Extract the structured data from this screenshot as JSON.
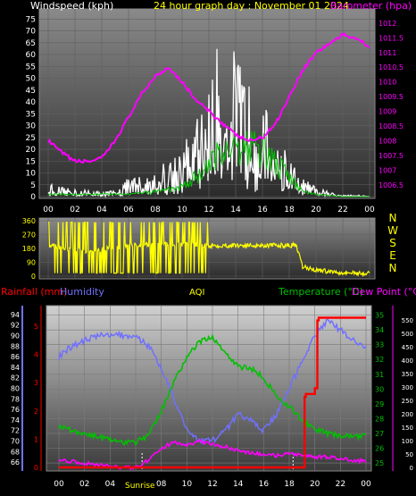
{
  "title": "24 hour graph day : November 01 2024",
  "colors": {
    "wind": "#ffffff",
    "gust": "#ffffff",
    "wind_avg": "#00c000",
    "baro": "#ff00ff",
    "dir": "#ffff00",
    "rain": "#ff0000",
    "humidity": "#7070ff",
    "aqi": "#ffff00",
    "temp": "#00c000",
    "dew": "#ff00ff",
    "axis_left_top": "#ffffff",
    "axis_right_top": "#ff00ff"
  },
  "chart_data": [
    {
      "type": "line",
      "name": "wind-barometer-panel",
      "left_axis_label": "Windspeed (kph)",
      "right_axis_label": "Barometer (hpa)",
      "x_ticks": [
        "00",
        "02",
        "04",
        "06",
        "08",
        "10",
        "12",
        "14",
        "16",
        "18",
        "20",
        "22",
        "00"
      ],
      "y_left_ticks": [
        0,
        5,
        10,
        15,
        20,
        25,
        30,
        35,
        40,
        45,
        50,
        55,
        60,
        65,
        70,
        75
      ],
      "y_left_lim": [
        0,
        77
      ],
      "y_right_ticks": [
        1006.5,
        1007,
        1007.5,
        1008,
        1008.5,
        1009,
        1009.5,
        1010,
        1010.5,
        1011,
        1011.5,
        1012
      ],
      "y_right_lim": [
        1006.1,
        1012.3
      ],
      "barometer": {
        "x": [
          0,
          1,
          2,
          3,
          4,
          5,
          6,
          7,
          8,
          9,
          10,
          11,
          12,
          13,
          14,
          15,
          16,
          17,
          18,
          19,
          20,
          21,
          22,
          23,
          24
        ],
        "y": [
          1008.0,
          1007.6,
          1007.3,
          1007.3,
          1007.4,
          1008.0,
          1008.8,
          1009.6,
          1010.2,
          1010.5,
          1010.0,
          1009.4,
          1009.0,
          1008.6,
          1008.2,
          1008.0,
          1008.1,
          1008.6,
          1009.5,
          1010.4,
          1011.0,
          1011.3,
          1011.6,
          1011.5,
          1011.2
        ]
      },
      "wind_gust_envelope": {
        "x": [
          0,
          1,
          2,
          3,
          4,
          5,
          6,
          7,
          8,
          9,
          10,
          11,
          12,
          13,
          14,
          15,
          16,
          17,
          18,
          19,
          20,
          21,
          22,
          23,
          24
        ],
        "y": [
          6,
          4,
          3,
          3,
          2,
          3,
          8,
          9,
          12,
          16,
          22,
          33,
          45,
          75,
          60,
          48,
          40,
          30,
          16,
          8,
          4,
          2,
          1,
          1,
          0
        ]
      },
      "wind_average": {
        "x": [
          0,
          2,
          4,
          6,
          8,
          10,
          12,
          13,
          14,
          16,
          18,
          19,
          20,
          22,
          24
        ],
        "y": [
          1,
          1,
          1,
          1,
          2,
          4,
          12,
          20,
          22,
          20,
          8,
          2,
          1,
          0,
          0
        ]
      }
    },
    {
      "type": "line",
      "name": "wind-direction-panel",
      "y_ticks": [
        0,
        90,
        180,
        270,
        360
      ],
      "y_lim": [
        0,
        360
      ],
      "right_labels": [
        "N",
        "W",
        "S",
        "E",
        "N"
      ],
      "direction": {
        "x": [
          0,
          3,
          6,
          9,
          12,
          15,
          18,
          18.5,
          19,
          20,
          21,
          22,
          23,
          24
        ],
        "y": [
          200,
          160,
          200,
          210,
          200,
          200,
          200,
          200,
          60,
          40,
          30,
          25,
          20,
          15
        ]
      }
    },
    {
      "type": "line",
      "name": "rain-humidity-temperature-panel",
      "rain_label": "Rainfall (mm)",
      "humidity_label": "Humidity",
      "aqi_label": "AQI",
      "temp_label": "Temperature (°C)",
      "dew_label": "Dew Point (°C)",
      "sunrise_label": "Sunrise",
      "sunrise_hour": 6.5,
      "sunset_hour": 18.3,
      "x_ticks": [
        "00",
        "02",
        "04",
        "06",
        "08",
        "10",
        "12",
        "14",
        "16",
        "18",
        "20",
        "22",
        "00"
      ],
      "humidity_ticks": [
        66,
        68,
        70,
        72,
        74,
        76,
        78,
        80,
        82,
        84,
        86,
        88,
        90,
        92,
        94
      ],
      "humidity_lim": [
        65,
        95
      ],
      "rain_ticks": [
        0,
        1,
        2,
        3,
        4,
        5
      ],
      "rain_lim": [
        0,
        5.6
      ],
      "temp_ticks": [
        25,
        26,
        27,
        28,
        29,
        30,
        31,
        32,
        33,
        34,
        35
      ],
      "temp_lim": [
        24.7,
        35.4
      ],
      "aqi_ticks": [
        0,
        50,
        100,
        150,
        200,
        250,
        300,
        350,
        400,
        450,
        500,
        550
      ],
      "aqi_lim": [
        0,
        590
      ],
      "humidity": {
        "x": [
          0,
          1,
          2,
          3,
          4,
          5,
          6,
          7,
          8,
          9,
          10,
          11,
          12,
          13,
          14,
          15,
          16,
          17,
          18,
          19,
          20,
          21,
          22,
          23,
          24
        ],
        "y": [
          86,
          88,
          89,
          90,
          90,
          90,
          90,
          88,
          84,
          78,
          72,
          70,
          70,
          72,
          75,
          74,
          72,
          75,
          80,
          85,
          90,
          93,
          91,
          89,
          88
        ]
      },
      "temperature": {
        "x": [
          0,
          1,
          2,
          3,
          4,
          5,
          6,
          7,
          8,
          9,
          10,
          11,
          12,
          13,
          14,
          15,
          16,
          17,
          18,
          19,
          20,
          21,
          22,
          23,
          24
        ],
        "y": [
          27.5,
          27.2,
          27.0,
          26.8,
          26.6,
          26.4,
          26.4,
          26.9,
          28.5,
          30.5,
          32.2,
          33.2,
          33.5,
          32.5,
          31.5,
          31.4,
          30.8,
          29.5,
          28.8,
          27.9,
          27.3,
          27.0,
          26.8,
          26.8,
          26.8
        ]
      },
      "dew_point": {
        "x": [
          0,
          1,
          2,
          3,
          4,
          5,
          6,
          7,
          8,
          9,
          10,
          11,
          12,
          13,
          14,
          15,
          16,
          17,
          18,
          19,
          20,
          21,
          22,
          23,
          24
        ],
        "y": [
          25.2,
          25.1,
          25.0,
          24.9,
          24.8,
          24.7,
          24.7,
          25.2,
          26.0,
          26.4,
          26.2,
          26.5,
          26.3,
          26.1,
          25.8,
          25.7,
          25.6,
          25.5,
          25.6,
          25.5,
          25.4,
          25.4,
          25.3,
          25.2,
          25.1
        ]
      },
      "rain": {
        "x": [
          0,
          19.0,
          19.2,
          19.3,
          20.0,
          20.2,
          20.3,
          24
        ],
        "y": [
          0,
          0,
          2.5,
          2.6,
          2.8,
          5.2,
          5.3,
          5.3
        ]
      }
    }
  ]
}
